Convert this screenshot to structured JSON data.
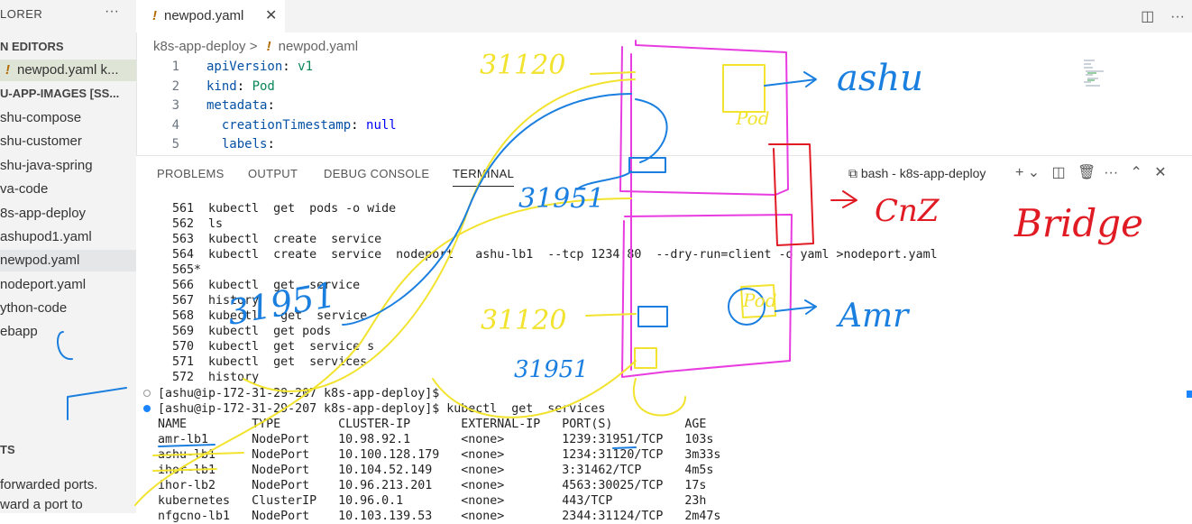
{
  "sidebar": {
    "title": "LORER",
    "more": "···",
    "open_editors_label": "N EDITORS",
    "open_file": "newpod.yaml  k...",
    "folder_label": "U-APP-IMAGES [SS...",
    "items": [
      "shu-compose",
      "shu-customer",
      "shu-java-spring",
      "va-code",
      "8s-app-deploy",
      "ashupod1.yaml",
      "newpod.yaml",
      "nodeport.yaml",
      "ython-code",
      "ebapp"
    ],
    "ports_label": "TS",
    "ports_text_1": "forwarded ports.",
    "ports_text_2": "ward a port to"
  },
  "tab": {
    "filename": "newpod.yaml",
    "modified_glyph": "!",
    "close": "✕"
  },
  "breadcrumb": {
    "folder": "k8s-app-deploy",
    "sep": ">",
    "file": "newpod.yaml"
  },
  "editor": {
    "lines": [
      {
        "num": "1",
        "key": "apiVersion",
        "val": "v1",
        "indent": ""
      },
      {
        "num": "2",
        "key": "kind",
        "val": "Pod",
        "indent": ""
      },
      {
        "num": "3",
        "key": "metadata",
        "val": "",
        "indent": ""
      },
      {
        "num": "4",
        "key": "creationTimestamp",
        "val": "null",
        "indent": "  "
      },
      {
        "num": "5",
        "key": "labels",
        "val": "",
        "indent": "  "
      }
    ]
  },
  "panel": {
    "tabs": [
      "PROBLEMS",
      "OUTPUT",
      "DEBUG CONSOLE",
      "TERMINAL"
    ],
    "active_tab": "TERMINAL",
    "terminal_name": "bash - k8s-app-deploy"
  },
  "terminal": {
    "history": [
      "  561  kubectl  get  pods -o wide",
      "  562  ls",
      "  563  kubectl  create  service",
      "  564  kubectl  create  service  nodeport   ashu-lb1  --tcp 1234:80  --dry-run=client -o yaml >nodeport.yaml",
      "  565*",
      "  566  kubectl  get  service",
      "  567  history",
      "  568  kubectl   get  service",
      "  569  kubectl  get pods",
      "  570  kubectl  get  service s",
      "  571  kubectl  get  services",
      "  572  history"
    ],
    "prompt1": "[ashu@ip-172-31-29-207 k8s-app-deploy]$",
    "prompt2": "[ashu@ip-172-31-29-207 k8s-app-deploy]$ kubectl  get  services",
    "table_header": "NAME         TYPE        CLUSTER-IP       EXTERNAL-IP   PORT(S)          AGE",
    "rows": [
      "amr-lb1      NodePort    10.98.92.1       <none>        1239:31951/TCP   103s",
      "ashu-lb1     NodePort    10.100.128.179   <none>        1234:31120/TCP   3m33s",
      "ihor-lb1     NodePort    10.104.52.149    <none>        3:31462/TCP      4m5s",
      "ihor-lb2     NodePort    10.96.213.201    <none>        4563:30025/TCP   17s",
      "kubernetes   ClusterIP   10.96.0.1        <none>        443/TCP          23h",
      "nfgcno-lb1   NodePort    10.103.139.53    <none>        2344:31124/TCP   2m47s"
    ]
  },
  "annotations": {
    "port_top": "31120",
    "port_mid": "31951",
    "port_lower": "31120",
    "port_lower2": "31951",
    "ashu": "ashu",
    "amr": "Amr",
    "pod_label": "Pod",
    "pod_label2": "Pod",
    "cut": "CnZ",
    "bridge": "Bridge",
    "left_num": "31951"
  },
  "colors": {
    "pink": "#e83ce0",
    "yellow": "#f2e32e",
    "blue": "#1b7fe0",
    "red": "#e01b24"
  }
}
